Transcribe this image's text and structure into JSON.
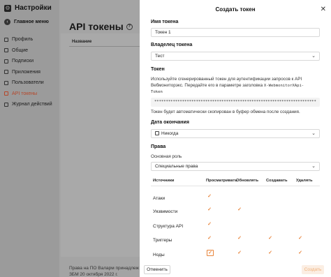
{
  "sidebar": {
    "title": "Настройки",
    "back_label": "Главное меню",
    "items": [
      {
        "label": "Профиль"
      },
      {
        "label": "Общие"
      },
      {
        "label": "Подписки"
      },
      {
        "label": "Приложения"
      },
      {
        "label": "Пользователи"
      },
      {
        "label": "API токены",
        "active": true
      },
      {
        "label": "Журнал действий"
      }
    ]
  },
  "main": {
    "page_title": "API токены",
    "column_name": "Название",
    "footer_note": "Права на ПО Валарм принадлежат",
    "footer_note_2": "ЗБМ 20 октября 2022 г."
  },
  "drawer": {
    "title": "Создать токен",
    "name_label": "Имя токена",
    "name_value": "Токен 1",
    "owner_label": "Владелец токена",
    "owner_value": "Тест",
    "token_label": "Токен",
    "token_desc_1": "Используйте сгенерированный токен для аутентификации запросов к API",
    "token_desc_2": "Вебмониторэкс. Передайте его в параметре заголовка",
    "token_header": "X-WebmonitorXApi-",
    "token_header_2": "Token",
    "token_masked": "**********************************************************************",
    "token_copied": "Токен будет автоматически скопирован в буфер обмена после создания.",
    "expiry_label": "Дата окончания",
    "expiry_value": "Никогда",
    "rights_label": "Права",
    "base_role_label": "Основная роль",
    "base_role_value": "Специальные права",
    "perm_columns": [
      "Источники",
      "Просматривать",
      "Обновлять",
      "Создавать",
      "Удалять"
    ],
    "perm_rows": [
      {
        "label": "Атаки",
        "view": true,
        "update": false,
        "create": false,
        "delete": false
      },
      {
        "label": "Уязвимости",
        "view": true,
        "update": true,
        "create": false,
        "delete": false
      },
      {
        "label": "Структура API",
        "view": true,
        "update": false,
        "create": false,
        "delete": false
      },
      {
        "label": "Триггеры",
        "view": true,
        "update": true,
        "create": true,
        "delete": true
      },
      {
        "label": "Ноды",
        "view": true,
        "update": true,
        "create": true,
        "delete": true
      }
    ],
    "cancel_label": "Отменить",
    "create_label": "Создать"
  },
  "colors": {
    "accent": "#e8843a",
    "active_nav": "#b5472a"
  }
}
